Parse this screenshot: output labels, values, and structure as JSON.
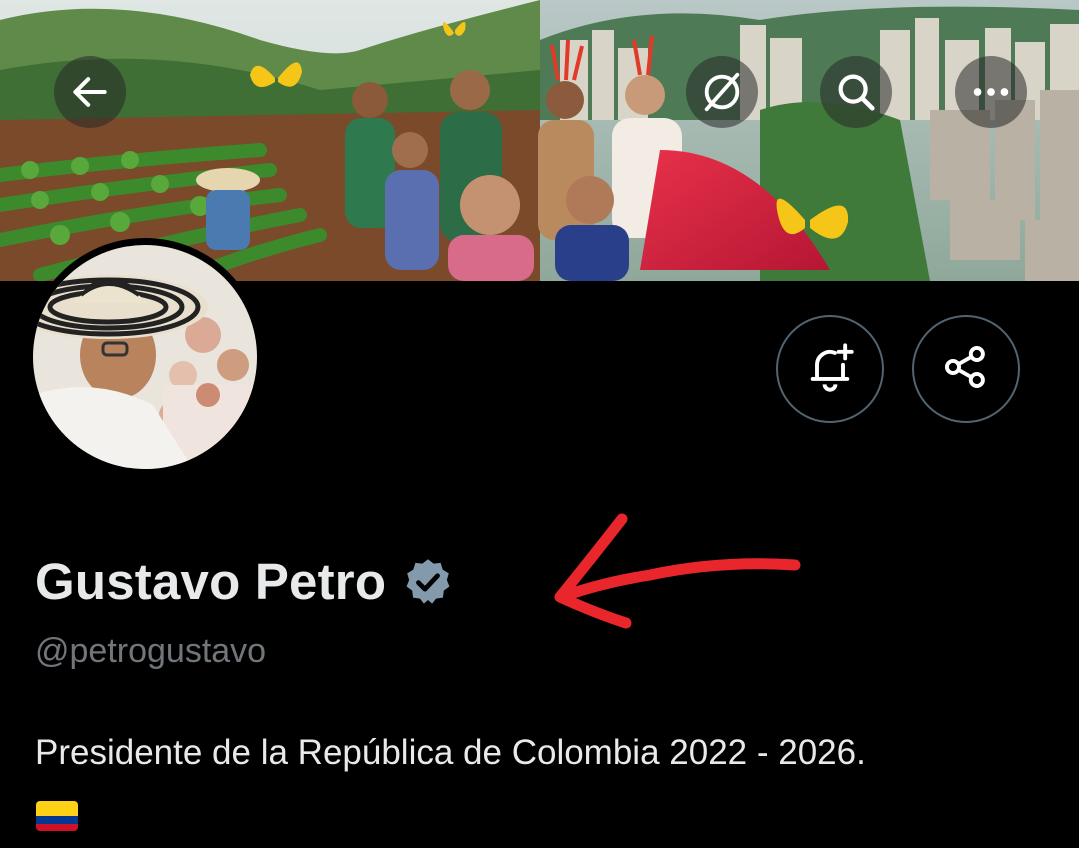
{
  "header": {
    "icons": [
      "back-arrow-icon",
      "grok-icon",
      "search-icon",
      "more-icon"
    ]
  },
  "profile": {
    "display_name": "Gustavo Petro",
    "verified_icon": "verified-badge-icon",
    "handle": "@petrogustavo",
    "bio": "Presidente de la República de Colombia 2022 - 2026.",
    "bio_emoji": "colombia-flag",
    "banner_image": "campo-y-ciudad-collage",
    "avatar_image": "profile-photo-sombrero-vueltiao"
  },
  "actions": {
    "icons": [
      "bell-plus-icon",
      "share-icon"
    ]
  },
  "annotation": {
    "type": "red-arrow-pointing-left",
    "color": "#e8262b"
  },
  "colors": {
    "background": "#000000",
    "primary_text": "#e7e9ea",
    "secondary_text": "#71767b",
    "button_border": "#536471",
    "verified_badge": "#829aab",
    "flag_yellow": "#fcd116",
    "flag_blue": "#003893",
    "flag_red": "#ce1126"
  }
}
